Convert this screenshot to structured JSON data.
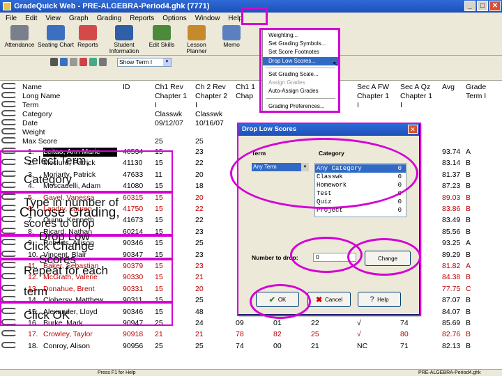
{
  "window": {
    "title": "GradeQuick Web - PRE-ALGEBRA-Period4.ghk (7771)"
  },
  "menu": [
    "File",
    "Edit",
    "View",
    "Graph",
    "Grading",
    "Reports",
    "Options",
    "Window",
    "Help"
  ],
  "toolbar": [
    {
      "label": "Attendance",
      "icon": "calendar-icon",
      "color": "#7a7f8c"
    },
    {
      "label": "Seating Chart",
      "icon": "seating-chart-icon",
      "color": "#3b6fc2"
    },
    {
      "label": "Reports",
      "icon": "reports-icon",
      "color": "#d44a4a"
    },
    {
      "label": "Student Information",
      "icon": "student-info-icon",
      "color": "#2f5fa8"
    },
    {
      "label": "Edit Skills",
      "icon": "edit-skills-icon",
      "color": "#4a8a3a"
    },
    {
      "label": "Lesson Planner",
      "icon": "lesson-planner-icon",
      "color": "#c78a2a"
    },
    {
      "label": "Memo",
      "icon": "memo-icon",
      "color": "#5a80c0"
    }
  ],
  "term_selector": {
    "value": "Show Term I"
  },
  "grading_menu": {
    "items": [
      {
        "label": "Weighting...",
        "state": "normal"
      },
      {
        "label": "Set Grading Symbols...",
        "state": "normal"
      },
      {
        "label": "Set Score Footnotes",
        "state": "normal"
      },
      {
        "label": "Drop Low Scores...",
        "state": "highlighted"
      },
      {
        "label": "Set Grading Scale...",
        "state": "normal"
      },
      {
        "label": "Assign Grades",
        "state": "disabled"
      },
      {
        "label": "Auto-Assign Grades",
        "state": "normal"
      },
      {
        "label": "Grading Preferences...",
        "state": "normal"
      }
    ]
  },
  "grid": {
    "header_rows": [
      {
        "label": "Name",
        "id": "ID",
        "c1": "Ch1 Rev",
        "c2": "Ch 2 Rev",
        "c3": "Ch1 1",
        "c8": "Sec A FW",
        "c9": "Sec A Qz",
        "avg": "Avg",
        "grade": "Grade"
      },
      {
        "label": "Long Name",
        "id": "",
        "c1": "Chapter 1",
        "c2": "Chapter 2",
        "c3": "Chap",
        "c8": "Chapter 1",
        "c9": "Chapter 1",
        "avg": "",
        "grade": "Term I"
      },
      {
        "label": "Term",
        "id": "",
        "c1": "I",
        "c2": "I",
        "c3": "",
        "c8": "I",
        "c9": "I",
        "avg": "",
        "grade": ""
      },
      {
        "label": "Category",
        "id": "",
        "c1": "Classwk",
        "c2": "Classwk",
        "c3": "",
        "c8": "",
        "c9": "",
        "avg": "",
        "grade": ""
      },
      {
        "label": "Date",
        "id": "",
        "c1": "09/12/07",
        "c2": "10/16/07",
        "c3": "",
        "c8": "",
        "c9": "",
        "avg": "",
        "grade": ""
      },
      {
        "label": "Weight",
        "id": "",
        "c1": "",
        "c2": "",
        "c3": "",
        "c8": "",
        "c9": "",
        "avg": "",
        "grade": ""
      },
      {
        "label": "Max Score",
        "id": "",
        "c1": "25",
        "c2": "25",
        "c3": "",
        "c8": "",
        "c9": "",
        "avg": "",
        "grade": ""
      }
    ],
    "students": [
      {
        "num": "1.",
        "name": "Leitao, Ann Marie",
        "id": "40534",
        "c1": "15",
        "c2": "23",
        "avg": "93.74",
        "grade": "A",
        "red": false,
        "selected": true
      },
      {
        "num": "2.",
        "name": "Mcclure, Patrick",
        "id": "41130",
        "c1": "15",
        "c2": "22",
        "avg": "83.14",
        "grade": "B",
        "red": false,
        "selected": false
      },
      {
        "num": "3.",
        "name": "Moriarty, Patrick",
        "id": "47633",
        "c1": "11",
        "c2": "20",
        "avg": "81.37",
        "grade": "B",
        "red": false,
        "selected": false
      },
      {
        "num": "4.",
        "name": "Moscadelli, Adam",
        "id": "41080",
        "c1": "15",
        "c2": "18",
        "avg": "87.23",
        "grade": "B",
        "red": false,
        "selected": false
      },
      {
        "num": "5.",
        "name": "Gavel, Vanessa",
        "id": "60315",
        "c1": "15",
        "c2": "20",
        "avg": "89.03",
        "grade": "B",
        "red": true,
        "selected": false
      },
      {
        "num": "6.",
        "name": "Landry, Lauren",
        "id": "41750",
        "c1": "15",
        "c2": "22",
        "avg": "83.86",
        "grade": "B",
        "red": true,
        "selected": false
      },
      {
        "num": "7.",
        "name": "Quinn, Kenneth",
        "id": "41673",
        "c1": "15",
        "c2": "22",
        "avg": "83.49",
        "grade": "B",
        "red": false,
        "selected": false
      },
      {
        "num": "8.",
        "name": "Ricard, Nathan",
        "id": "60214",
        "c1": "15",
        "c2": "23",
        "avg": "85.56",
        "grade": "B",
        "red": false,
        "selected": false
      },
      {
        "num": "9.",
        "name": "Roberts, Allison",
        "id": "90346",
        "c1": "15",
        "c2": "25",
        "avg": "93.25",
        "grade": "A",
        "red": false,
        "selected": false
      },
      {
        "num": "10.",
        "name": "Vincent, Blair",
        "id": "90347",
        "c1": "15",
        "c2": "23",
        "avg": "89.29",
        "grade": "B",
        "red": false,
        "selected": false
      },
      {
        "num": "11.",
        "name": "Baker, Sebastian",
        "id": "90379",
        "c1": "15",
        "c2": "23",
        "avg": "81.82",
        "grade": "A",
        "red": true,
        "selected": false
      },
      {
        "num": "12.",
        "name": "McGrath, Valerie",
        "id": "90330",
        "c1": "15",
        "c2": "21",
        "avg": "84.38",
        "grade": "B",
        "red": true,
        "selected": false
      },
      {
        "num": "13.",
        "name": "Donahue, Brent",
        "id": "90331",
        "c1": "15",
        "c2": "20",
        "avg": "77.75",
        "grade": "C",
        "red": true,
        "selected": false
      },
      {
        "num": "14.",
        "name": "Clohersy, Matthew",
        "id": "90311",
        "c1": "15",
        "c2": "25",
        "avg": "87.07",
        "grade": "B",
        "red": false,
        "selected": false
      },
      {
        "num": "15.",
        "name": "Alexander, Lloyd",
        "id": "90346",
        "c1": "15",
        "c2": "48",
        "avg": "84.07",
        "grade": "B",
        "red": false,
        "selected": false
      },
      {
        "num": "16.",
        "name": "Burke, Mark",
        "id": "90947",
        "c1": "25",
        "c2": "24",
        "c3": "09",
        "c4": "01",
        "c5": "22",
        "c8": "√",
        "c9": "74",
        "avg": "85.69",
        "grade": "B",
        "red": false,
        "selected": false
      },
      {
        "num": "17.",
        "name": "Crowley, Taylor",
        "id": "90918",
        "c1": "21",
        "c2": "21",
        "c3": "78",
        "c4": "82",
        "c5": "25",
        "c8": "√",
        "c9": "80",
        "avg": "82.76",
        "grade": "B",
        "red": true,
        "selected": false
      },
      {
        "num": "18.",
        "name": "Conroy, Alison",
        "id": "90956",
        "c1": "25",
        "c2": "25",
        "c3": "74",
        "c4": "00",
        "c5": "21",
        "c8": "NC",
        "c9": "71",
        "avg": "82.13",
        "grade": "B",
        "red": false,
        "selected": false
      }
    ]
  },
  "dialog": {
    "title": "Drop Low Scores",
    "term_label": "Term",
    "category_label": "Category",
    "term_value": "Any Term",
    "categories": [
      {
        "name": "Any Category",
        "count": "0",
        "selected": true
      },
      {
        "name": "Classwk",
        "count": "0",
        "selected": false
      },
      {
        "name": "Homework",
        "count": "0",
        "selected": false
      },
      {
        "name": "Test",
        "count": "0",
        "selected": false
      },
      {
        "name": "Quiz",
        "count": "0",
        "selected": false
      },
      {
        "name": "Project",
        "count": "0",
        "selected": false
      }
    ],
    "number_label": "Number to drop:",
    "number_value": "0",
    "change_label": "Change",
    "ok_label": "OK",
    "cancel_label": "Cancel",
    "help_label": "Help"
  },
  "instructions": [
    "Select Term,",
    "Category",
    "Type in number of",
    "scores to drop",
    "Choose Grading,",
    "Drop Low",
    "Click Change",
    "Scores",
    "Repeat for each",
    "term",
    "Click OK"
  ],
  "statusbar": {
    "left": "Press F1 for Help",
    "right": "PRE-ALGEBRA-Period4.ghk"
  },
  "colors": {
    "annotation": "#d400d4",
    "selection": "#316ac5",
    "title_bar": "#1f4fb8"
  }
}
